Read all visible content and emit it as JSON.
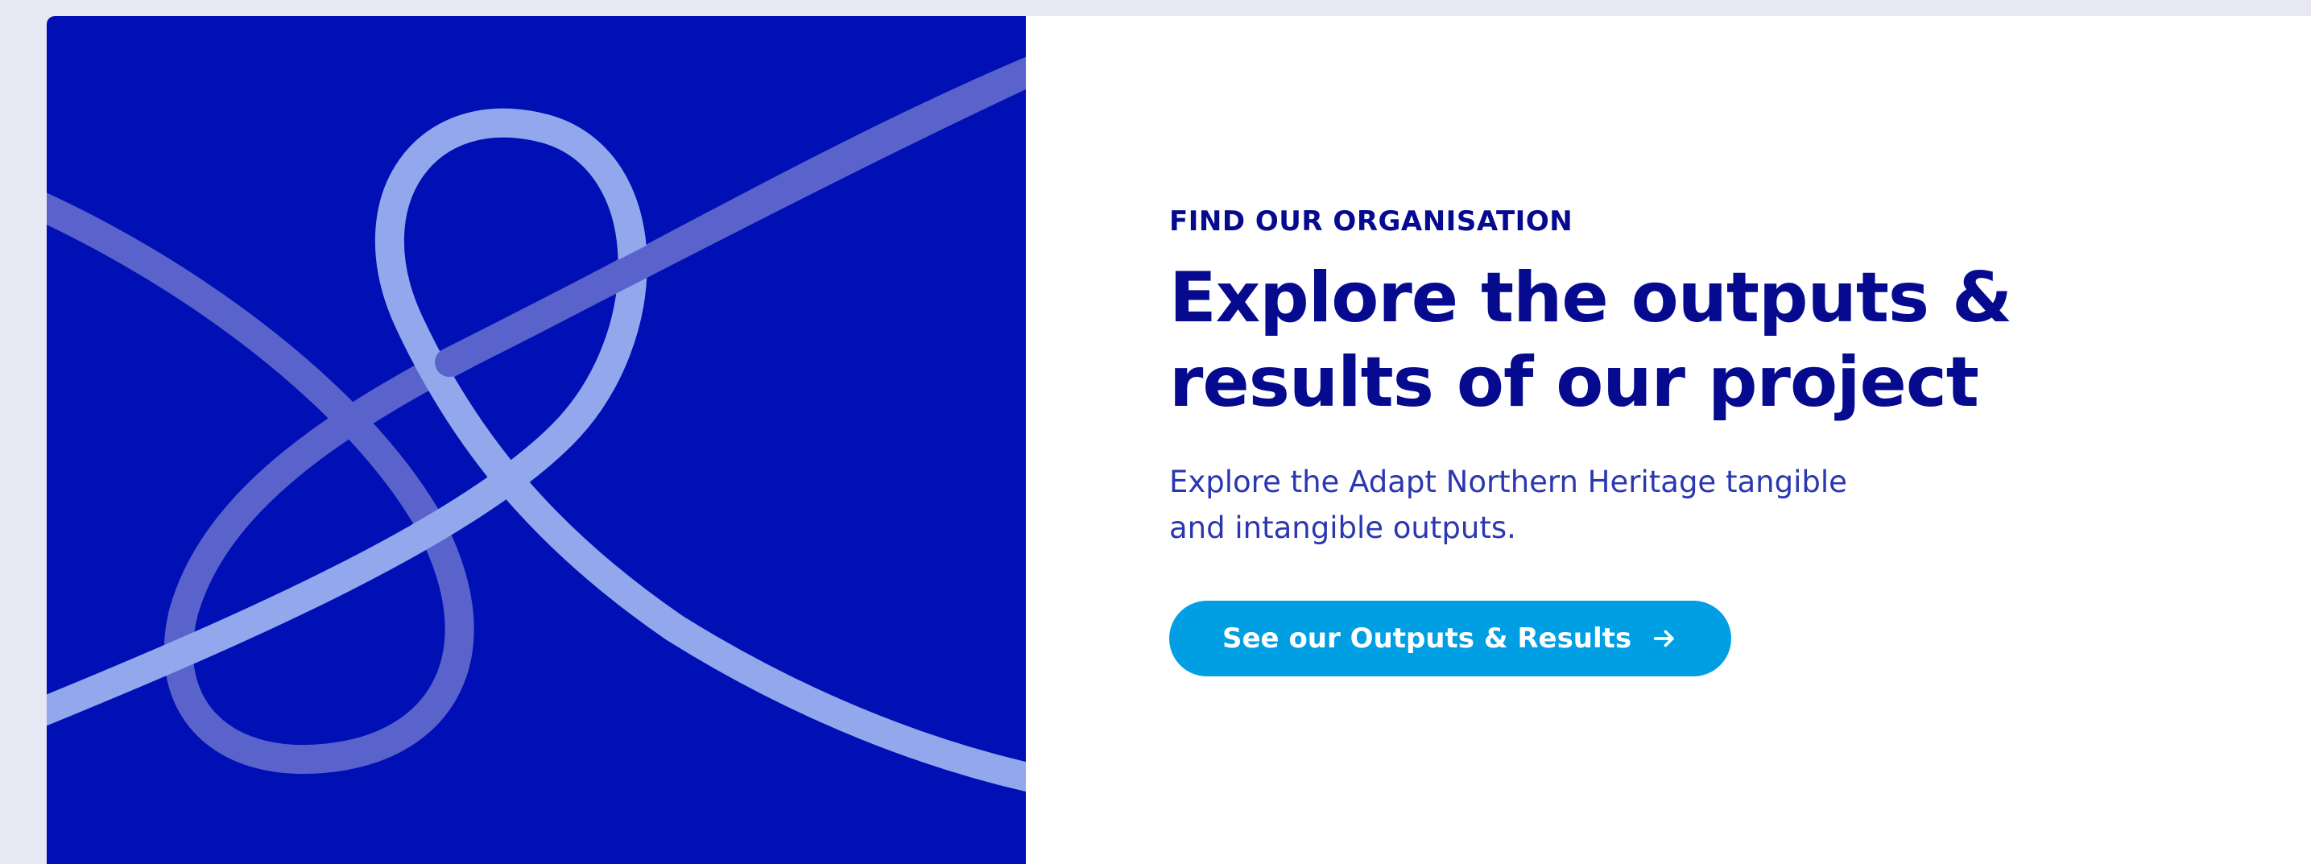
{
  "hero": {
    "eyebrow": "FIND OUR ORGANISATION",
    "headline_line1": "Explore the outputs &",
    "headline_line2": "results of our project",
    "description_line1": "Explore the Adapt Northern Heritage tangible",
    "description_line2": "and intangible outputs.",
    "cta_label": "See our Outputs & Results",
    "cta_icon": "arrow-right-icon"
  },
  "colors": {
    "page_background": "#e8e8f4",
    "art_background": "#0110b5",
    "ribbon_light": "#93a8ec",
    "ribbon_mid": "#5a63cb",
    "heading": "#050a8f",
    "body_text": "#2b37b0",
    "cta_background": "#009fe3",
    "cta_text": "#ffffff"
  }
}
